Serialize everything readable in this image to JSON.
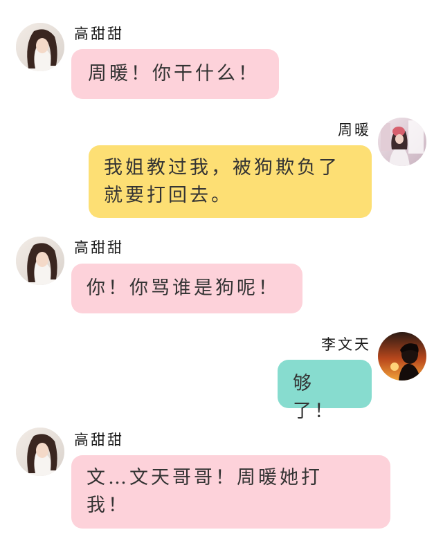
{
  "conversation": {
    "messages": [
      {
        "sender": "高甜甜",
        "side": "left",
        "avatar": "girl-portrait-avatar",
        "text": "周暖！你干什么！",
        "bubble_color": "#fdd2da"
      },
      {
        "sender": "周暖",
        "side": "right",
        "avatar": "girl-in-room-avatar",
        "text": "我姐教过我，被狗欺负了就要打回去。",
        "bubble_color": "#fddf74"
      },
      {
        "sender": "高甜甜",
        "side": "left",
        "avatar": "girl-portrait-avatar",
        "text": "你！你骂谁是狗呢！",
        "bubble_color": "#fdd2da"
      },
      {
        "sender": "李文天",
        "side": "right",
        "avatar": "boy-sunset-avatar",
        "text": "够了！",
        "bubble_color": "#87dccf"
      },
      {
        "sender": "高甜甜",
        "side": "left",
        "avatar": "girl-portrait-avatar",
        "text": "文…文天哥哥！周暖她打我！",
        "bubble_color": "#fdd2da"
      }
    ]
  }
}
